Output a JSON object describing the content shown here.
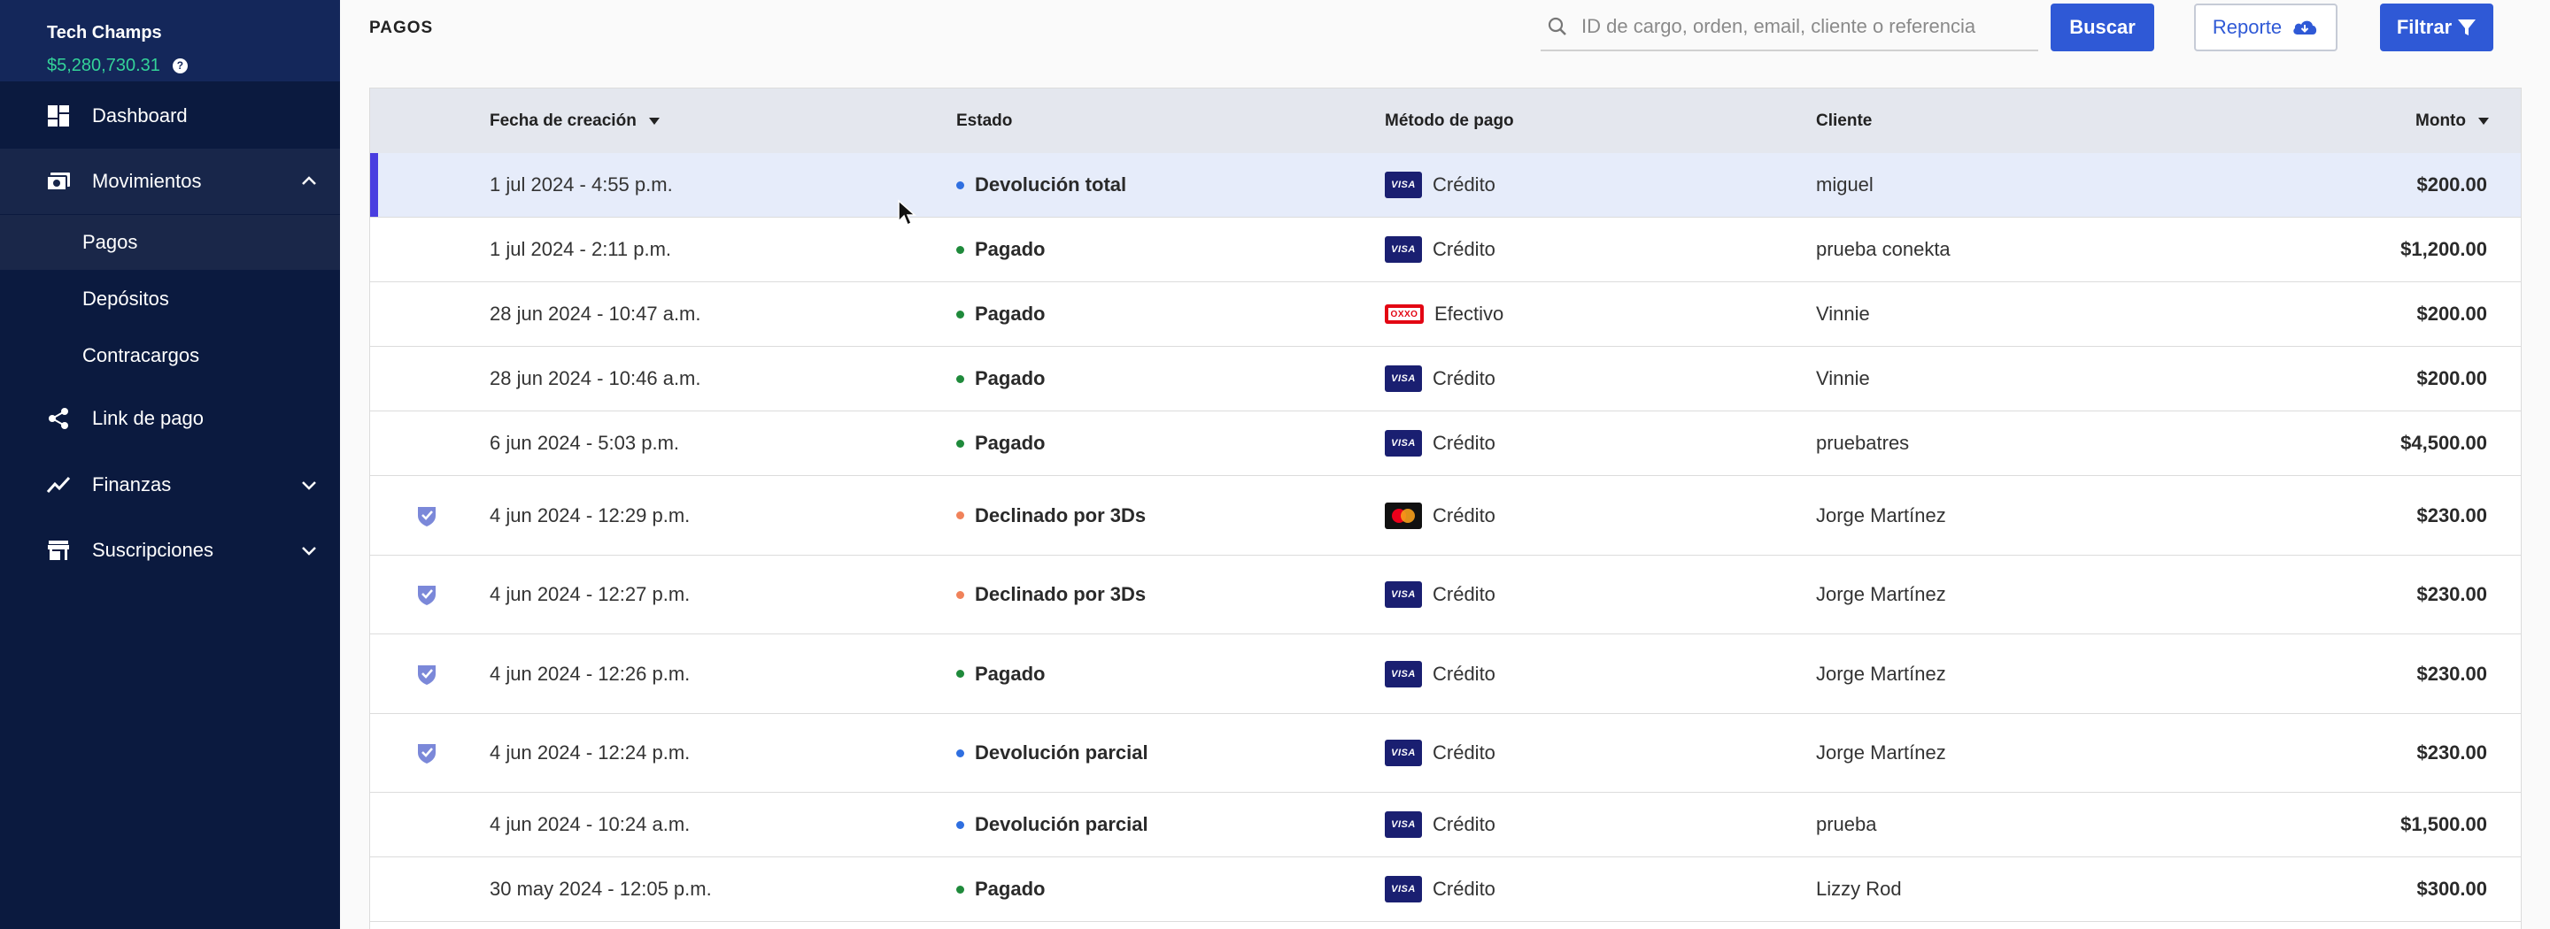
{
  "sidebar": {
    "brand_name": "Tech Champs",
    "balance": "$5,280,730.31",
    "help_glyph": "?",
    "nav": [
      {
        "label": "Dashboard",
        "icon": "dashboard-icon"
      },
      {
        "label": "Movimientos",
        "icon": "money-icon",
        "expanded": true
      },
      {
        "label": "Link de pago",
        "icon": "share-icon"
      },
      {
        "label": "Finanzas",
        "icon": "trending-up-icon"
      },
      {
        "label": "Suscripciones",
        "icon": "store-icon"
      }
    ],
    "sub_items": [
      {
        "label": "Pagos",
        "active": true
      },
      {
        "label": "Depósitos"
      },
      {
        "label": "Contracargos"
      }
    ]
  },
  "header": {
    "title": "PAGOS",
    "search_placeholder": "ID de cargo, orden, email, cliente o referencia",
    "buscar_label": "Buscar",
    "reporte_label": "Reporte",
    "filtrar_label": "Filtrar"
  },
  "table": {
    "columns": {
      "date": "Fecha de creación",
      "status": "Estado",
      "method": "Método de pago",
      "client": "Cliente",
      "amount": "Monto"
    },
    "rows": [
      {
        "date": "1 jul 2024 - 4:55 p.m.",
        "status": "Devolución total",
        "status_color": "#2f6fe0",
        "card": "visa",
        "method": "Crédito",
        "client": "miguel",
        "amount": "$200.00",
        "secure": false,
        "selected": true
      },
      {
        "date": "1 jul 2024 - 2:11 p.m.",
        "status": "Pagado",
        "status_color": "#1f8a3b",
        "card": "visa",
        "method": "Crédito",
        "client": "prueba conekta",
        "amount": "$1,200.00",
        "secure": false
      },
      {
        "date": "28 jun 2024 - 10:47 a.m.",
        "status": "Pagado",
        "status_color": "#1f8a3b",
        "card": "oxxo",
        "method": "Efectivo",
        "client": "Vinnie",
        "amount": "$200.00",
        "secure": false
      },
      {
        "date": "28 jun 2024 - 10:46 a.m.",
        "status": "Pagado",
        "status_color": "#1f8a3b",
        "card": "visa",
        "method": "Crédito",
        "client": "Vinnie",
        "amount": "$200.00",
        "secure": false
      },
      {
        "date": "6 jun 2024 - 5:03 p.m.",
        "status": "Pagado",
        "status_color": "#1f8a3b",
        "card": "visa",
        "method": "Crédito",
        "client": "pruebatres",
        "amount": "$4,500.00",
        "secure": false
      },
      {
        "date": "4 jun 2024 - 12:29 p.m.",
        "status": "Declinado por 3Ds",
        "status_color": "#f0825a",
        "card": "mastercard",
        "method": "Crédito",
        "client": "Jorge Martínez",
        "amount": "$230.00",
        "secure": true
      },
      {
        "date": "4 jun 2024 - 12:27 p.m.",
        "status": "Declinado por 3Ds",
        "status_color": "#f0825a",
        "card": "visa",
        "method": "Crédito",
        "client": "Jorge Martínez",
        "amount": "$230.00",
        "secure": true
      },
      {
        "date": "4 jun 2024 - 12:26 p.m.",
        "status": "Pagado",
        "status_color": "#1f8a3b",
        "card": "visa",
        "method": "Crédito",
        "client": "Jorge Martínez",
        "amount": "$230.00",
        "secure": true
      },
      {
        "date": "4 jun 2024 - 12:24 p.m.",
        "status": "Devolución parcial",
        "status_color": "#2f6fe0",
        "card": "visa",
        "method": "Crédito",
        "client": "Jorge Martínez",
        "amount": "$230.00",
        "secure": true
      },
      {
        "date": "4 jun 2024 - 10:24 a.m.",
        "status": "Devolución parcial",
        "status_color": "#2f6fe0",
        "card": "visa",
        "method": "Crédito",
        "client": "prueba",
        "amount": "$1,500.00",
        "secure": false
      },
      {
        "date": "30 may 2024 - 12:05 p.m.",
        "status": "Pagado",
        "status_color": "#1f8a3b",
        "card": "visa",
        "method": "Crédito",
        "client": "Lizzy Rod",
        "amount": "$300.00",
        "secure": false
      }
    ]
  },
  "card_labels": {
    "visa": "VISA",
    "oxxo": "OXXO"
  }
}
